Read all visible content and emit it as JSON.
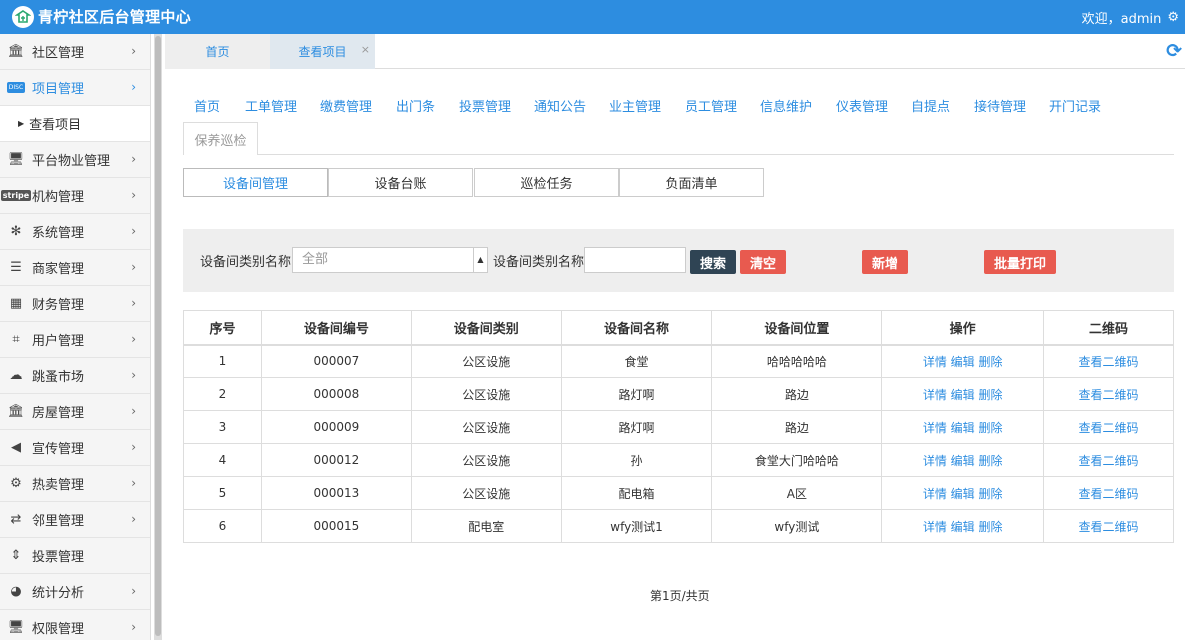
{
  "header": {
    "brand": "青柠社区后台管理中心",
    "user_text": "欢迎，admin"
  },
  "sidebar": {
    "items": [
      {
        "label": "社区管理",
        "icon": "bank-icon"
      },
      {
        "label": "项目管理",
        "icon": "discover-icon"
      },
      {
        "label": "平台物业管理",
        "icon": "monitor-icon"
      },
      {
        "label": "机构管理",
        "icon": "stripe-icon"
      },
      {
        "label": "系统管理",
        "icon": "yelp-icon"
      },
      {
        "label": "商家管理",
        "icon": "list-icon"
      },
      {
        "label": "财务管理",
        "icon": "calculator-icon"
      },
      {
        "label": "用户管理",
        "icon": "crop-icon"
      },
      {
        "label": "跳蚤市场",
        "icon": "cloud-icon"
      },
      {
        "label": "房屋管理",
        "icon": "bank-icon"
      },
      {
        "label": "宣传管理",
        "icon": "volume-icon"
      },
      {
        "label": "热卖管理",
        "icon": "gear-icon"
      },
      {
        "label": "邻里管理",
        "icon": "retweet-icon"
      },
      {
        "label": "投票管理",
        "icon": "sort-icon"
      },
      {
        "label": "统计分析",
        "icon": "pie-chart-icon"
      },
      {
        "label": "权限管理",
        "icon": "monitor-icon"
      }
    ],
    "sub_item": "查看项目"
  },
  "tabs": {
    "home": "首页",
    "current": "查看项目",
    "close": "×"
  },
  "modules": [
    "首页",
    "工单管理",
    "缴费管理",
    "出门条",
    "投票管理",
    "通知公告",
    "业主管理",
    "员工管理",
    "信息维护",
    "仪表管理",
    "自提点",
    "接待管理",
    "开门记录"
  ],
  "active_module": "保养巡检",
  "subtabs": [
    "设备间管理",
    "设备台账",
    "巡检任务",
    "负面清单"
  ],
  "search": {
    "label1": "设备间类别名称",
    "select_value": "全部",
    "label2": "设备间类别名称",
    "search_btn": "搜索",
    "clear_btn": "清空",
    "add_btn": "新增",
    "print_btn": "批量打印"
  },
  "table": {
    "headers": [
      "序号",
      "设备间编号",
      "设备间类别",
      "设备间名称",
      "设备间位置",
      "操作",
      "二维码"
    ],
    "rows": [
      {
        "no": "1",
        "code": "000007",
        "category": "公区设施",
        "name": "食堂",
        "location": "哈哈哈哈哈"
      },
      {
        "no": "2",
        "code": "000008",
        "category": "公区设施",
        "name": "路灯啊",
        "location": "路边"
      },
      {
        "no": "3",
        "code": "000009",
        "category": "公区设施",
        "name": "路灯啊",
        "location": "路边"
      },
      {
        "no": "4",
        "code": "000012",
        "category": "公区设施",
        "name": "孙",
        "location": "食堂大门哈哈哈"
      },
      {
        "no": "5",
        "code": "000013",
        "category": "公区设施",
        "name": "配电箱",
        "location": "A区"
      },
      {
        "no": "6",
        "code": "000015",
        "category": "配电室",
        "name": "wfy测试1",
        "location": "wfy测试"
      }
    ],
    "actions": {
      "detail": "详情",
      "edit": "编辑",
      "delete": "删除"
    },
    "qrcode_link": "查看二维码"
  },
  "pager": "第1页/共页",
  "colors": {
    "primary": "#2d8de0",
    "danger": "#e85a4f",
    "dark_button": "#2f4454"
  }
}
